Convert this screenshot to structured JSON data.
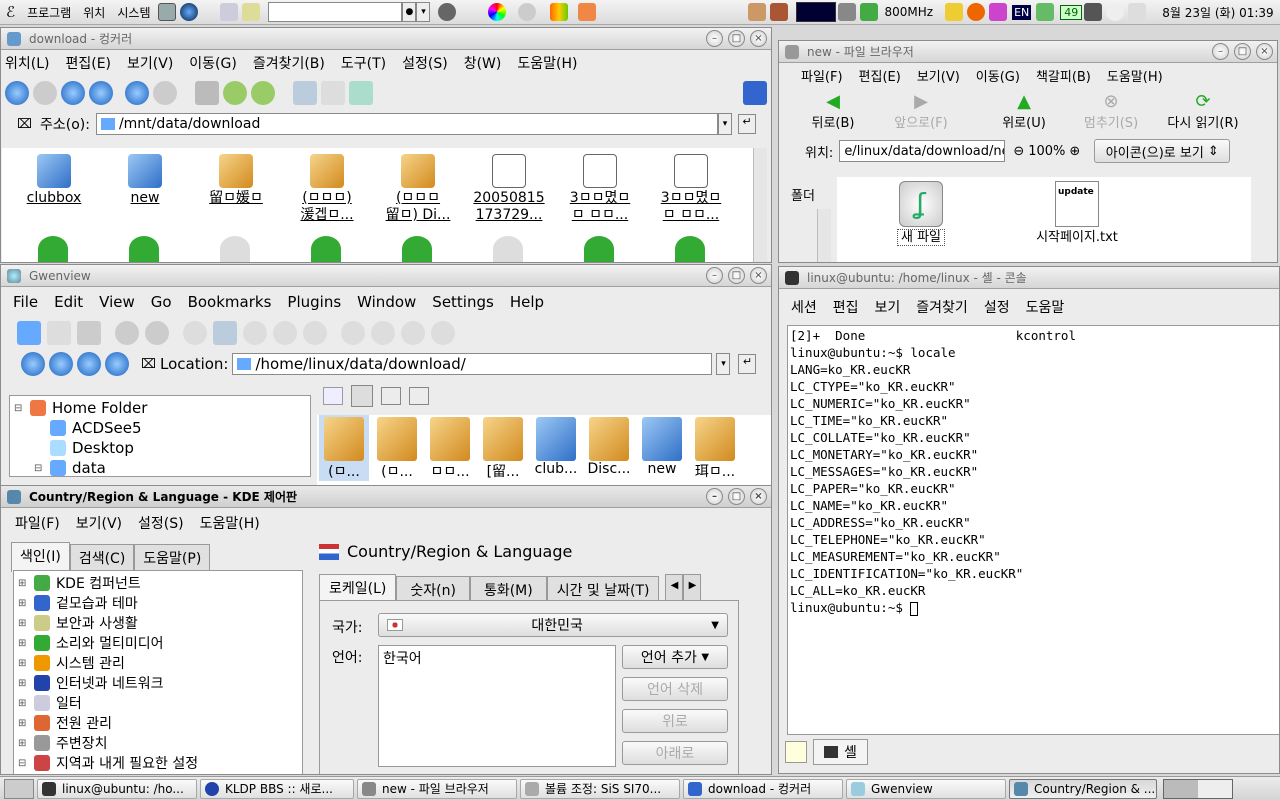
{
  "top_panel": {
    "menus": [
      "프로그램",
      "위치",
      "시스템"
    ],
    "cpu_freq": "800MHz",
    "kbd_layout": "EN",
    "temp": "49",
    "clock": "8월 23일 (화) 01:39"
  },
  "konqueror": {
    "title": "download - 컹커러",
    "menu": [
      "위치(L)",
      "편집(E)",
      "보기(V)",
      "이동(G)",
      "즐겨찾기(B)",
      "도구(T)",
      "설정(S)",
      "창(W)",
      "도움말(H)"
    ],
    "address_label": "주소(o):",
    "address_value": "/mnt/data/download",
    "files_row1": [
      "clubbox",
      "new",
      "留ㅁ媛ㅁ",
      "(ㅁㅁㅁ)\n湲겝ㅁ...",
      "(ㅁㅁㅁ\n留ㅁ) Di...",
      "20050815\n173729...",
      "3ㅁㅁ몄ㅁ\nㅁ ㅁㅁ...",
      "3ㅁㅁ몄ㅁ\nㅁ ㅁㅁ..."
    ]
  },
  "nautilus": {
    "title": "new - 파일 브라우저",
    "menu": [
      "파일(F)",
      "편집(E)",
      "보기(V)",
      "이동(G)",
      "책갈피(B)",
      "도움말(H)"
    ],
    "nav_buttons": [
      "뒤로(B)",
      "앞으로(F)",
      "위로(U)",
      "멈추기(S)",
      "다시 읽기(R)"
    ],
    "location_label": "위치:",
    "location_value": "e/linux/data/download/new",
    "zoom": "100%",
    "view_mode": "아이콘(으)로 보기",
    "side_label": "폴더",
    "files": [
      "새 파일",
      "시작페이지.txt"
    ],
    "update_badge": "update"
  },
  "gwenview": {
    "title": "Gwenview",
    "menu": [
      "File",
      "Edit",
      "View",
      "Go",
      "Bookmarks",
      "Plugins",
      "Window",
      "Settings",
      "Help"
    ],
    "location_label": "Location:",
    "location_value": "/home/linux/data/download/",
    "tree": [
      "Home Folder",
      "ACDSee5",
      "Desktop",
      "data"
    ],
    "thumbs": [
      "(ㅁ...",
      "(ㅁ...",
      "ㅁㅁ...",
      "[留...",
      "club...",
      "Disc...",
      "new",
      "珥ㅁ..."
    ]
  },
  "terminal": {
    "title": "linux@ubuntu: /home/linux - 셸 - 콘솔",
    "menu": [
      "세션",
      "편집",
      "보기",
      "즐겨찾기",
      "설정",
      "도움말"
    ],
    "lines": [
      "[2]+  Done                    kcontrol",
      "linux@ubuntu:~$ locale",
      "LANG=ko_KR.eucKR",
      "LC_CTYPE=\"ko_KR.eucKR\"",
      "LC_NUMERIC=\"ko_KR.eucKR\"",
      "LC_TIME=\"ko_KR.eucKR\"",
      "LC_COLLATE=\"ko_KR.eucKR\"",
      "LC_MONETARY=\"ko_KR.eucKR\"",
      "LC_MESSAGES=\"ko_KR.eucKR\"",
      "LC_PAPER=\"ko_KR.eucKR\"",
      "LC_NAME=\"ko_KR.eucKR\"",
      "LC_ADDRESS=\"ko_KR.eucKR\"",
      "LC_TELEPHONE=\"ko_KR.eucKR\"",
      "LC_MEASUREMENT=\"ko_KR.eucKR\"",
      "LC_IDENTIFICATION=\"ko_KR.eucKR\"",
      "LC_ALL=ko_KR.eucKR",
      "linux@ubuntu:~$ "
    ],
    "tab_label": "셸"
  },
  "kcontrol": {
    "title": "Country/Region & Language - KDE 제어판",
    "menu": [
      "파일(F)",
      "보기(V)",
      "설정(S)",
      "도움말(H)"
    ],
    "side_tabs": [
      "색인(I)",
      "검색(C)",
      "도움말(P)"
    ],
    "tree": [
      "KDE 컴퍼넌트",
      "겉모습과 테마",
      "보안과 사생활",
      "소리와 멀티미디어",
      "시스템 관리",
      "인터넷과 네트워크",
      "일터",
      "전원 관리",
      "주변장치",
      "지역과 내게 필요한 설정"
    ],
    "header": "Country/Region & Language",
    "tabs": [
      "로케일(L)",
      "숫자(n)",
      "통화(M)",
      "시간 및 날짜(T)"
    ],
    "country_label": "국가:",
    "country_value": "대한민국",
    "language_label": "언어:",
    "language_items": [
      "한국어"
    ],
    "buttons": [
      "언어 추가",
      "언어 삭제",
      "위로",
      "아래로"
    ]
  },
  "taskbar": {
    "tasks": [
      "linux@ubuntu: /ho...",
      "KLDP BBS :: 새로...",
      "new - 파일 브라우저",
      "볼륨 조정: SiS SI70...",
      "download - 컹커러",
      "Gwenview",
      "Country/Region & ..."
    ]
  }
}
